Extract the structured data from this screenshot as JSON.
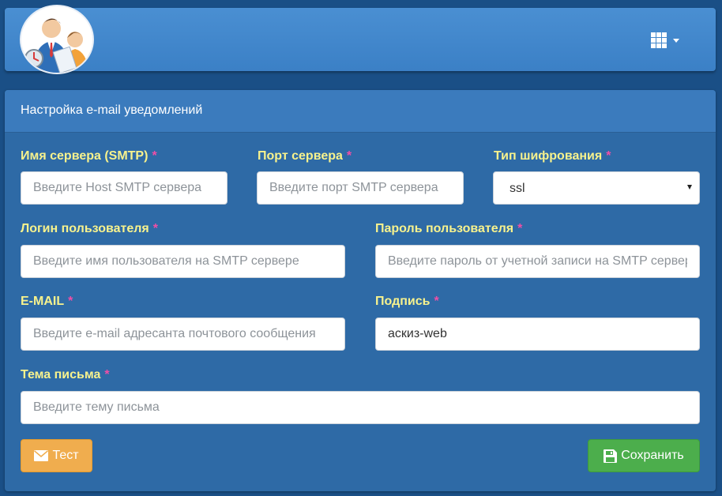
{
  "header": {
    "avatar_icon": "business-people-icon",
    "apps_icon": "grid-icon",
    "menu_icon": "caret-down-icon"
  },
  "panel": {
    "title": "Настройка e-mail уведомлений"
  },
  "form": {
    "required_mark": "*",
    "smtp_server": {
      "label": "Имя сервера (SMTP)",
      "placeholder": "Введите Host SMTP сервера",
      "value": ""
    },
    "smtp_port": {
      "label": "Порт сервера",
      "placeholder": "Введите порт SMTP сервера",
      "value": ""
    },
    "encryption": {
      "label": "Тип шифрования",
      "value": "ssl"
    },
    "login": {
      "label": "Логин пользователя",
      "placeholder": "Введите имя пользователя на SMTP сервере",
      "value": ""
    },
    "password": {
      "label": "Пароль пользователя",
      "placeholder": "Введите пароль от учетной записи на SMTP сервере",
      "value": ""
    },
    "email": {
      "label": "E-MAIL",
      "placeholder": "Введите e-mail адресанта почтового сообщения",
      "value": ""
    },
    "signature": {
      "label": "Подпись",
      "placeholder": "",
      "value": "аскиз-web"
    },
    "subject": {
      "label": "Тема письма",
      "placeholder": "Введите тему письма",
      "value": ""
    }
  },
  "buttons": {
    "test_label": "Тест",
    "test_icon": "envelope-icon",
    "save_label": "Сохранить",
    "save_icon": "floppy-disk-icon"
  },
  "colors": {
    "page_background": "#1a4f86",
    "topbar": "#4a8fd2",
    "panel": "#2e6aa6",
    "label": "#f7f28d",
    "required": "#f04ea6",
    "test_button": "#f0ad4e",
    "save_button": "#4cae4c"
  }
}
